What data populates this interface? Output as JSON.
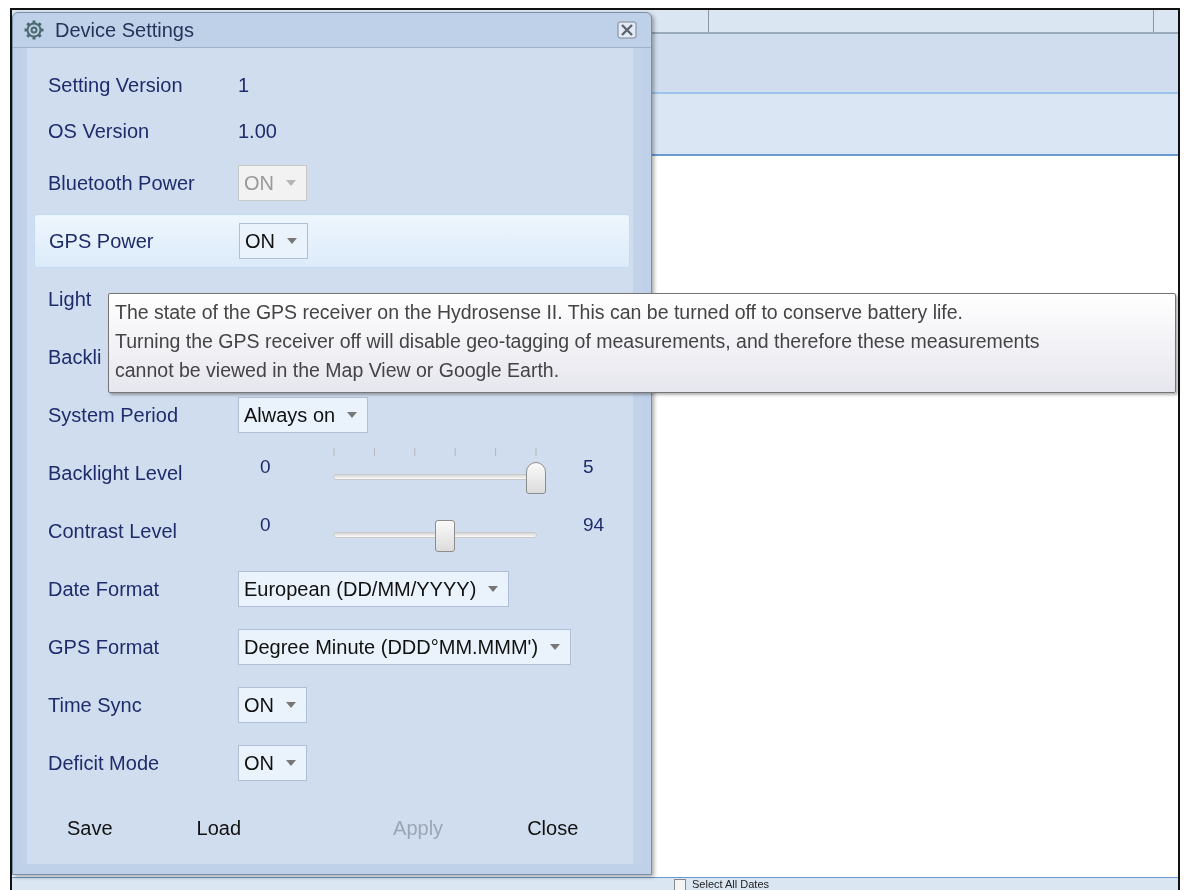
{
  "window": {
    "title": "Device Settings"
  },
  "rows": [
    {
      "kind": "text",
      "label": "Setting Version",
      "value": "1",
      "highlighted": false
    },
    {
      "kind": "text",
      "label": "OS Version",
      "value": "1.00",
      "highlighted": false
    },
    {
      "kind": "combo",
      "label": "Bluetooth Power",
      "value": "ON",
      "disabled": true,
      "highlighted": false
    },
    {
      "kind": "combo",
      "label": "GPS Power",
      "value": "ON",
      "disabled": false,
      "highlighted": true
    },
    {
      "kind": "covered",
      "label": "Light",
      "highlighted": false
    },
    {
      "kind": "covered",
      "label": "Backli",
      "highlighted": false
    },
    {
      "kind": "combo",
      "label": "System Period",
      "value": "Always on",
      "disabled": false,
      "highlighted": false
    },
    {
      "kind": "slider",
      "label": "Backlight Level",
      "min": "0",
      "max": "5",
      "level": 1,
      "ticks": true,
      "highlighted": false
    },
    {
      "kind": "slider",
      "label": "Contrast Level",
      "min": "0",
      "max": "94",
      "level": 0.55,
      "ticks": false,
      "highlighted": false
    },
    {
      "kind": "combo",
      "label": "Date Format",
      "value": "European (DD/MM/YYYY)",
      "disabled": false,
      "highlighted": false
    },
    {
      "kind": "combo",
      "label": "GPS Format",
      "value": "Degree Minute (DDD°MM.MMM')",
      "disabled": false,
      "highlighted": false
    },
    {
      "kind": "combo",
      "label": "Time Sync",
      "value": "ON",
      "disabled": false,
      "highlighted": false
    },
    {
      "kind": "combo",
      "label": "Deficit Mode",
      "value": "ON",
      "disabled": false,
      "highlighted": false
    }
  ],
  "tooltip": {
    "lines": [
      "The state of the GPS receiver on the Hydrosense II. This can be turned off to conserve battery life.",
      "Turning the GPS receiver off will disable geo-tagging of measurements, and therefore these measurements",
      "cannot be viewed in the Map View or Google Earth."
    ]
  },
  "buttons": [
    {
      "label": "Save",
      "disabled": false
    },
    {
      "label": "Load",
      "disabled": false
    },
    {
      "label": "Apply",
      "disabled": true
    },
    {
      "label": "Close",
      "disabled": false
    }
  ],
  "background": {
    "checkbox": {
      "label": "Select All Dates",
      "checked": false
    }
  }
}
